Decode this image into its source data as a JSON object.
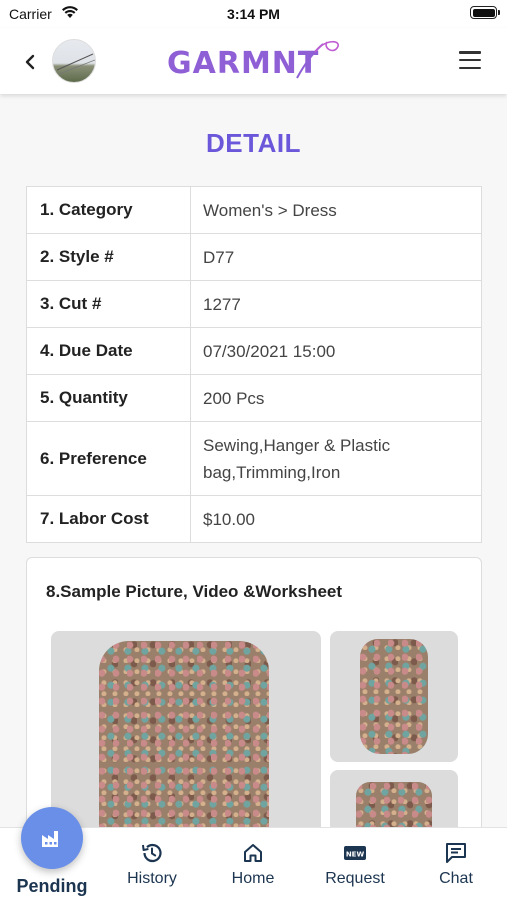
{
  "status_bar": {
    "carrier": "Carrier",
    "time": "3:14 PM"
  },
  "header": {
    "logo_text": "GARMNT",
    "back_icon": "chevron-left-icon",
    "menu_icon": "hamburger-icon"
  },
  "page_title": "DETAIL",
  "details": [
    {
      "label": "1. Category",
      "value": "Women's > Dress"
    },
    {
      "label": "2. Style #",
      "value": "D77"
    },
    {
      "label": "3. Cut #",
      "value": "1277"
    },
    {
      "label": "4. Due Date",
      "value": "07/30/2021 15:00"
    },
    {
      "label": "5. Quantity",
      "value": "200 Pcs"
    },
    {
      "label": "6. Preference",
      "value": "Sewing,Hanger & Plastic bag,Trimming,Iron"
    },
    {
      "label": "7. Labor Cost",
      "value": "$10.00"
    }
  ],
  "media": {
    "title": "8.Sample Picture, Video &Worksheet"
  },
  "bottom_nav": [
    {
      "label": "Pending",
      "icon": "factory-icon",
      "active": true
    },
    {
      "label": "History",
      "icon": "history-icon"
    },
    {
      "label": "Home",
      "icon": "home-icon"
    },
    {
      "label": "Request",
      "icon": "new-badge-icon"
    },
    {
      "label": "Chat",
      "icon": "chat-icon"
    }
  ],
  "colors": {
    "accent": "#6b57d9",
    "logo": "#8f5fd6",
    "fab": "#6a8fe8",
    "nav_text": "#1c3550"
  }
}
